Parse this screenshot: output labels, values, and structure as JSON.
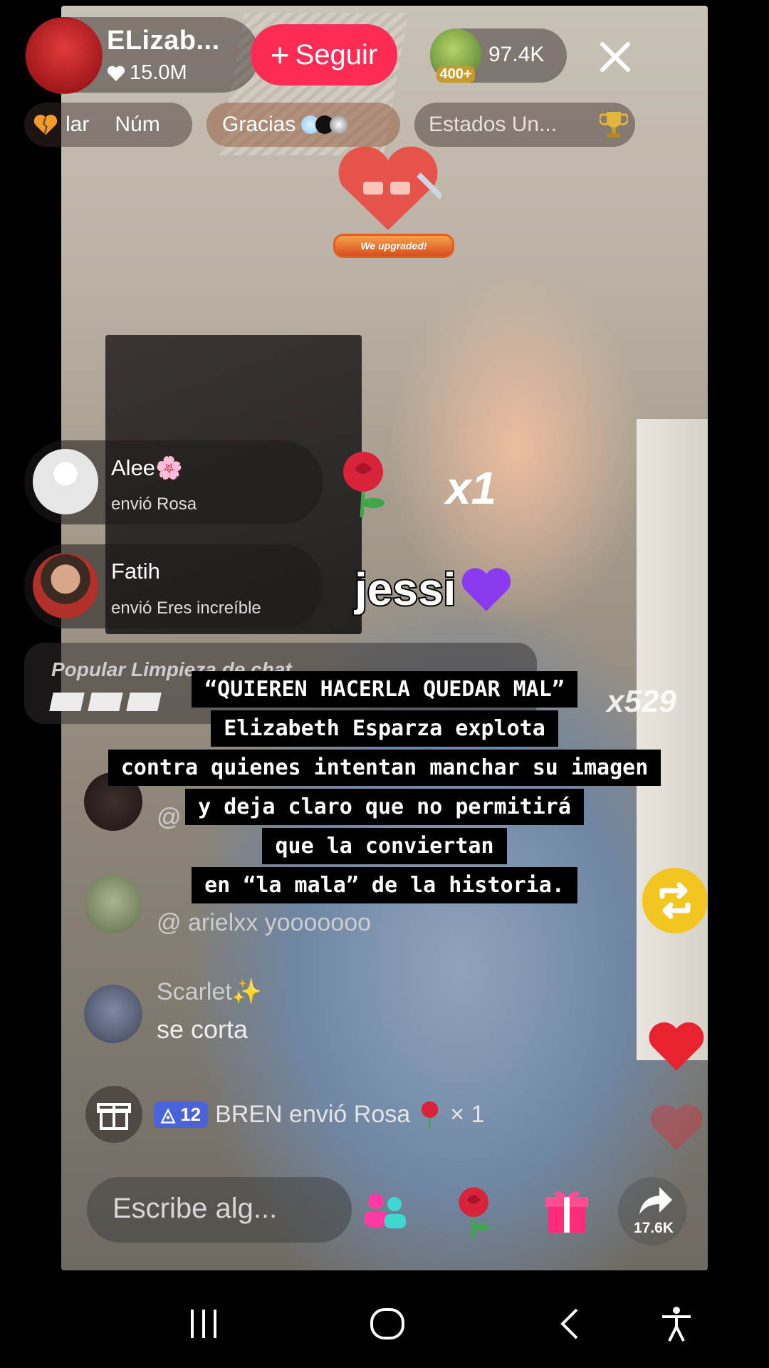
{
  "host": {
    "name": "ELizab...",
    "likes": "15.0M",
    "follow_label": "Seguir",
    "viewer_badge": "400+",
    "viewer_count": "97.4K"
  },
  "subbar": {
    "item1_a": "lar",
    "item1_b": "Núm",
    "item2": "Gracias",
    "item3": "Estados Un..."
  },
  "sticker": {
    "label": "We upgraded!"
  },
  "gifts": [
    {
      "user": "Alee🌸",
      "text": "envió Rosa",
      "count": "x1"
    },
    {
      "user": "Fatih",
      "text": "envió Eres increíble"
    }
  ],
  "overlay_name": "jessi",
  "popular": {
    "title": "Popular Limpieza de chat",
    "multiplier": "x529"
  },
  "caption": [
    "“QUIEREN HACERLA QUEDAR MAL”",
    "Elizabeth Esparza explota",
    "contra quienes intentan manchar su imagen",
    "y deja claro que no permitirá",
    "que la conviertan",
    "en “la mala” de la historia."
  ],
  "chat": [
    {
      "user": "@",
      "message": ""
    },
    {
      "user": "@ arielxx",
      "message": "yooooooo"
    },
    {
      "user": "Scarlet✨",
      "message": "se corta"
    }
  ],
  "gift_notice": {
    "level": "12",
    "text": "BREN envió Rosa",
    "count": "× 1"
  },
  "input": {
    "placeholder": "Escribe alg..."
  },
  "share": {
    "count": "17.6K"
  },
  "colors": {
    "follow": "#fe2c55",
    "repost": "#f2c520",
    "heart": "#e8232f",
    "level_badge": "#4a63d8"
  }
}
